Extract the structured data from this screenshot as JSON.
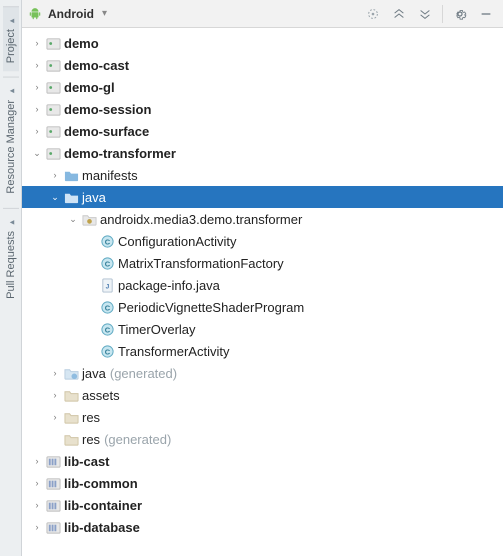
{
  "side_tabs": [
    {
      "label": "Project",
      "active": true
    },
    {
      "label": "Resource Manager",
      "active": false
    },
    {
      "label": "Pull Requests",
      "active": false
    }
  ],
  "header": {
    "title": "Android"
  },
  "tree": [
    {
      "depth": 0,
      "arrow": "e",
      "icon": "module",
      "label": "demo",
      "bold": true
    },
    {
      "depth": 0,
      "arrow": "e",
      "icon": "module",
      "label": "demo-cast",
      "bold": true
    },
    {
      "depth": 0,
      "arrow": "e",
      "icon": "module",
      "label": "demo-gl",
      "bold": true
    },
    {
      "depth": 0,
      "arrow": "e",
      "icon": "module",
      "label": "demo-session",
      "bold": true
    },
    {
      "depth": 0,
      "arrow": "e",
      "icon": "module",
      "label": "demo-surface",
      "bold": true
    },
    {
      "depth": 0,
      "arrow": "c",
      "icon": "module",
      "label": "demo-transformer",
      "bold": true
    },
    {
      "depth": 1,
      "arrow": "e",
      "icon": "folder",
      "label": "manifests"
    },
    {
      "depth": 1,
      "arrow": "c",
      "icon": "folder",
      "label": "java",
      "selected": true
    },
    {
      "depth": 2,
      "arrow": "c",
      "icon": "package",
      "label": "androidx.media3.demo.transformer"
    },
    {
      "depth": 3,
      "arrow": "",
      "icon": "class",
      "label": "ConfigurationActivity"
    },
    {
      "depth": 3,
      "arrow": "",
      "icon": "class",
      "label": "MatrixTransformationFactory"
    },
    {
      "depth": 3,
      "arrow": "",
      "icon": "javafile",
      "label": "package-info.java"
    },
    {
      "depth": 3,
      "arrow": "",
      "icon": "class",
      "label": "PeriodicVignetteShaderProgram"
    },
    {
      "depth": 3,
      "arrow": "",
      "icon": "class",
      "label": "TimerOverlay"
    },
    {
      "depth": 3,
      "arrow": "",
      "icon": "class",
      "label": "TransformerActivity"
    },
    {
      "depth": 1,
      "arrow": "e",
      "icon": "genfolder",
      "label": "java",
      "suffix": "(generated)"
    },
    {
      "depth": 1,
      "arrow": "e",
      "icon": "resfolder",
      "label": "assets"
    },
    {
      "depth": 1,
      "arrow": "e",
      "icon": "resfolder",
      "label": "res"
    },
    {
      "depth": 1,
      "arrow": "",
      "icon": "resfolder",
      "label": "res",
      "suffix": "(generated)"
    },
    {
      "depth": 0,
      "arrow": "e",
      "icon": "libmodule",
      "label": "lib-cast",
      "bold": true
    },
    {
      "depth": 0,
      "arrow": "e",
      "icon": "libmodule",
      "label": "lib-common",
      "bold": true
    },
    {
      "depth": 0,
      "arrow": "e",
      "icon": "libmodule",
      "label": "lib-container",
      "bold": true
    },
    {
      "depth": 0,
      "arrow": "e",
      "icon": "libmodule",
      "label": "lib-database",
      "bold": true
    }
  ]
}
